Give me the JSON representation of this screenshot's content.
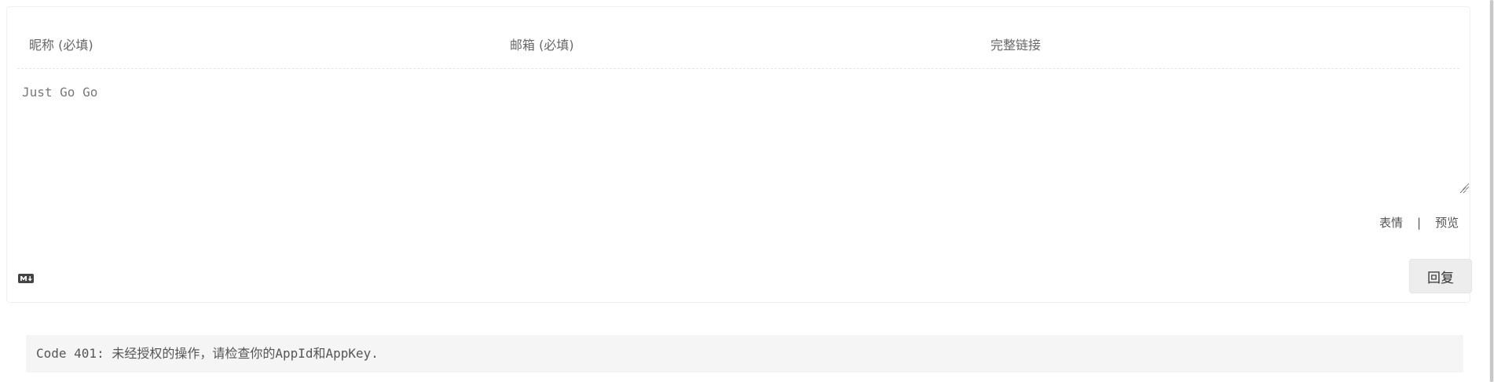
{
  "comment_form": {
    "nickname_placeholder": "昵称 (必填)",
    "email_placeholder": "邮箱 (必填)",
    "link_placeholder": "完整链接",
    "editor_placeholder": "Just Go Go",
    "emoji_label": "表情",
    "separator": "|",
    "preview_label": "预览",
    "reply_label": "回复",
    "markdown_icon": "markdown-icon"
  },
  "error": {
    "message": "Code 401: 未经授权的操作，请检查你的AppId和AppKey."
  },
  "colors": {
    "button_bg": "#ededed",
    "error_bg": "#f5f5f5",
    "text": "#555555"
  }
}
